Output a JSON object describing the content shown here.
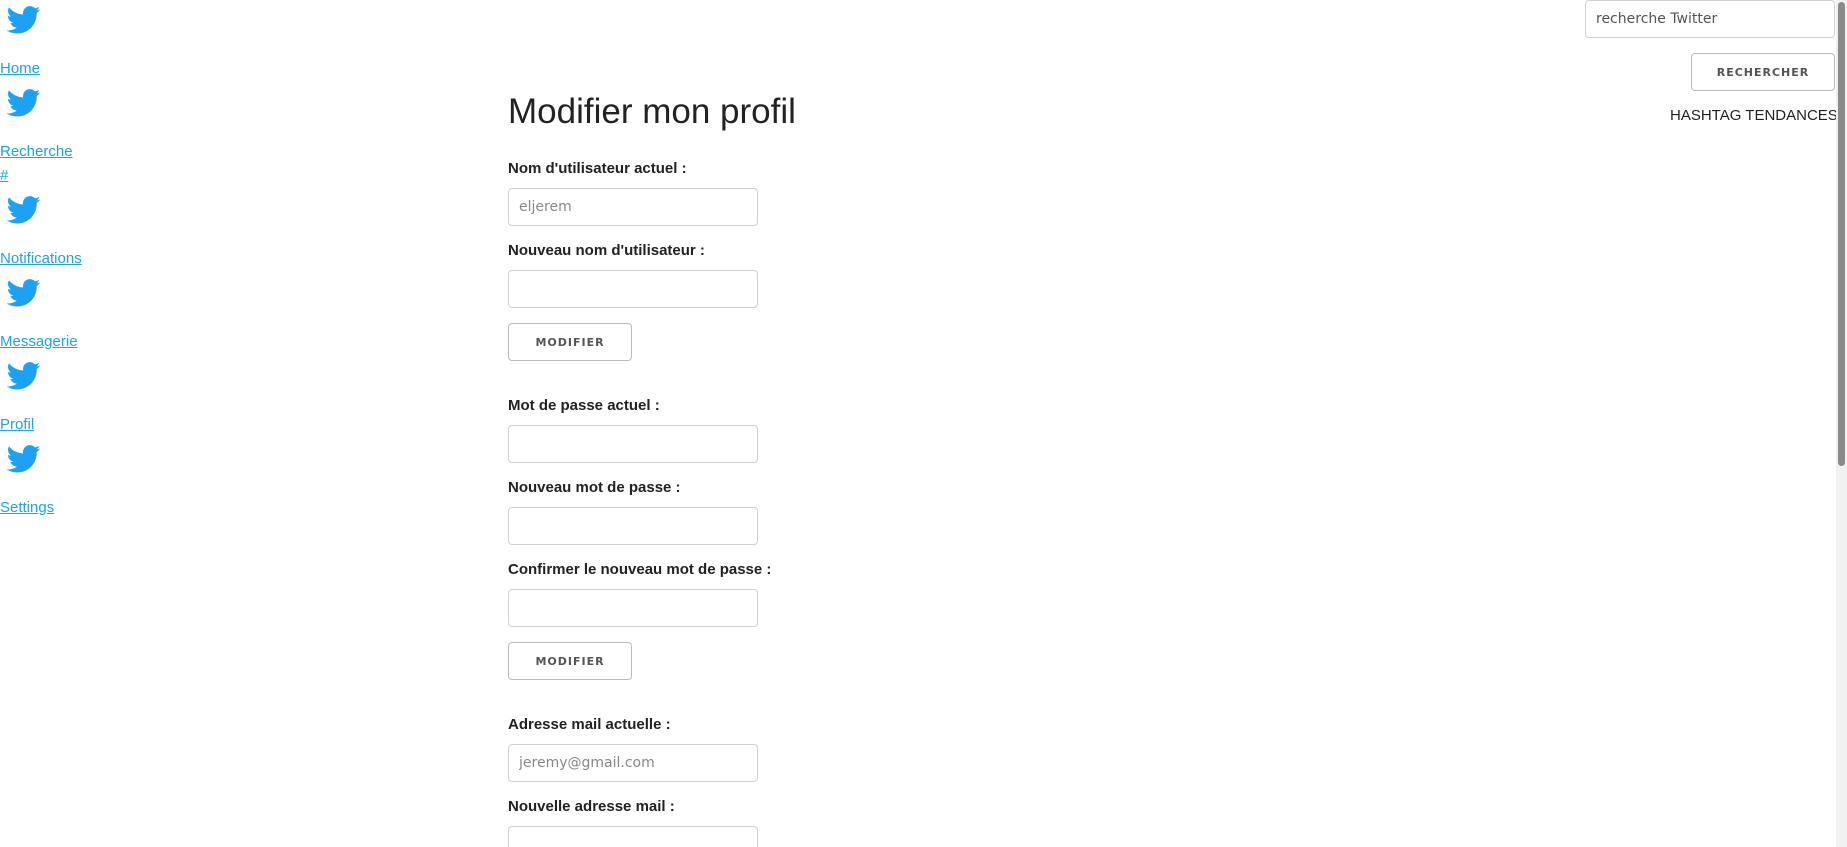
{
  "nav": {
    "items": [
      {
        "label": "Home",
        "icon": "twitter-bird-icon"
      },
      {
        "label": "Recherche",
        "extra": "#",
        "icon": "twitter-bird-icon"
      },
      {
        "label": "Notifications",
        "icon": "twitter-bird-icon"
      },
      {
        "label": "Messagerie",
        "icon": "twitter-bird-icon"
      },
      {
        "label": "Profil",
        "icon": "twitter-bird-icon"
      },
      {
        "label": "Settings",
        "icon": "twitter-bird-icon"
      }
    ]
  },
  "main": {
    "title": "Modifier mon profil",
    "username_section": {
      "current_label": "Nom d'utilisateur actuel :",
      "current_placeholder": "eljerem",
      "new_label": "Nouveau nom d'utilisateur :",
      "button": "Modifier"
    },
    "password_section": {
      "current_label": "Mot de passe actuel :",
      "new_label": "Nouveau mot de passe :",
      "confirm_label": "Confirmer le nouveau mot de passe :",
      "button": "Modifier"
    },
    "email_section": {
      "current_label": "Adresse mail actuelle :",
      "current_placeholder": "jeremy@gmail.com",
      "new_label": "Nouvelle adresse mail :"
    }
  },
  "right": {
    "search_placeholder": "recherche Twitter",
    "search_button": "Rechercher",
    "trending_title": "HASHTAG TENDANCES"
  },
  "colors": {
    "link": "#1da1f2",
    "text": "#222222",
    "border": "#d1d1d1"
  }
}
